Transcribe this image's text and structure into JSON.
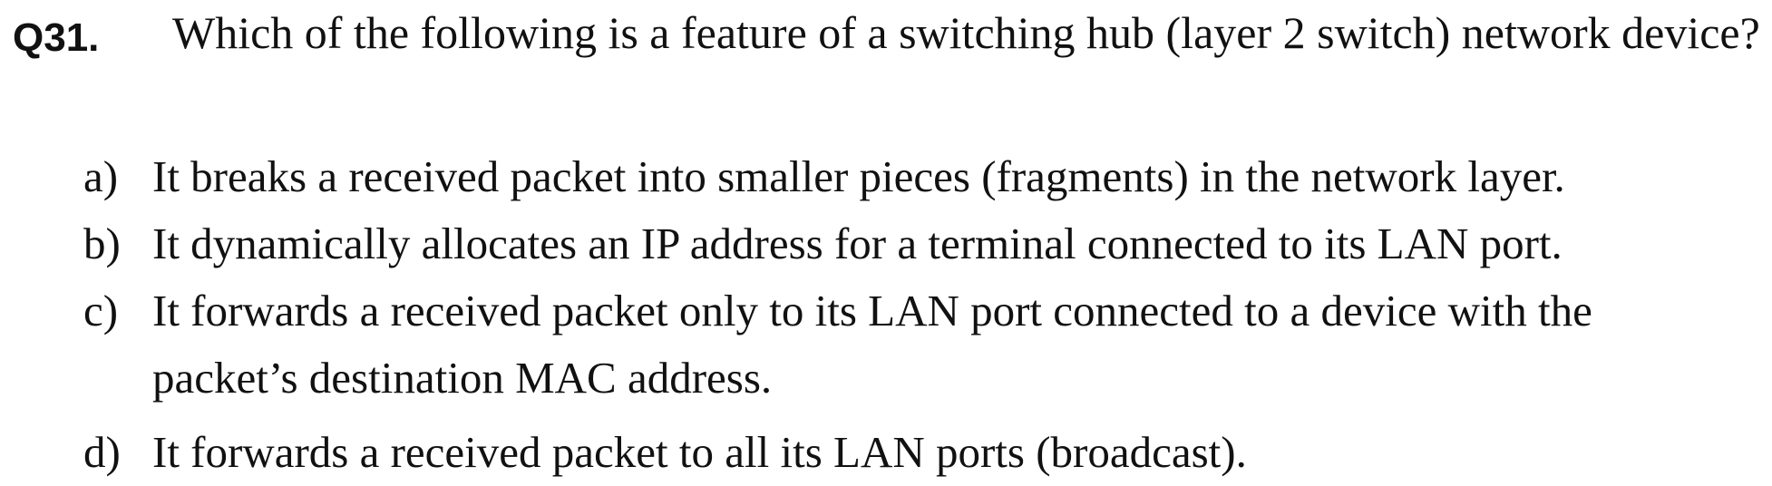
{
  "question": {
    "number": "Q31.",
    "text": "Which of the following is a feature of a switching hub (layer 2 switch) network device?"
  },
  "options": [
    {
      "letter": "a)",
      "text": "It breaks a received packet into smaller pieces (fragments) in the network layer."
    },
    {
      "letter": "b)",
      "text": "It dynamically allocates an IP address for a terminal connected to its LAN port."
    },
    {
      "letter": "c)",
      "line1": "It forwards a received packet only to its LAN port connected to a device with the",
      "line2": "packet’s destination MAC address."
    },
    {
      "letter": "d)",
      "text": "It forwards a received packet to all its LAN ports (broadcast)."
    }
  ]
}
